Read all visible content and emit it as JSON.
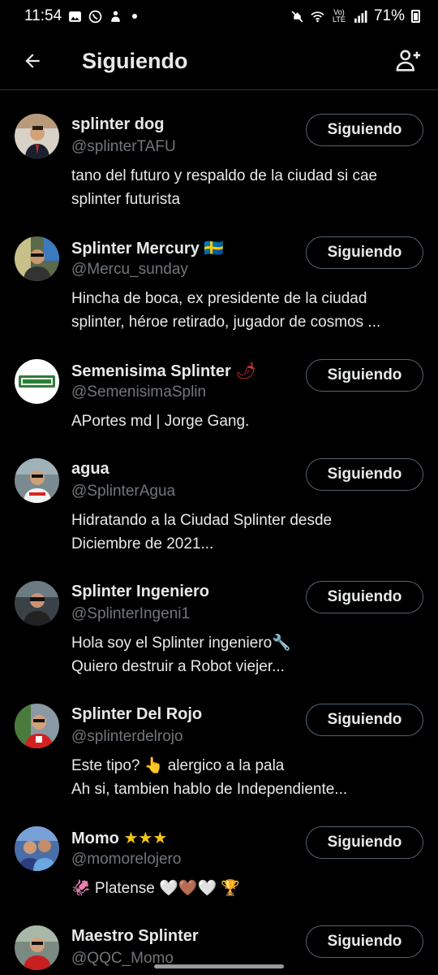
{
  "status_bar": {
    "time": "11:54",
    "battery": "71%",
    "network": "Vo) LTE"
  },
  "header": {
    "title": "Siguiendo"
  },
  "accounts": [
    {
      "name": "splinter dog",
      "badge": "",
      "handle": "@splinterTAFU",
      "bio": "tano del futuro y respaldo de la ciudad si cae\nsplinter futurista",
      "button": "Siguiendo"
    },
    {
      "name": "Splinter Mercury",
      "badge": "🇸🇪",
      "handle": "@Mercu_sunday",
      "bio": "Hincha de boca, ex presidente de la ciudad\nsplinter, héroe retirado, jugador de cosmos ...",
      "button": "Siguiendo"
    },
    {
      "name": "Semenisima Splinter",
      "badge": "🌶",
      "handle": "@SemenisimaSplin",
      "bio": "APortes md | Jorge Gang.",
      "button": "Siguiendo"
    },
    {
      "name": "agua",
      "badge": "",
      "handle": "@SplinterAgua",
      "bio": "Hidratando a la Ciudad Splinter desde\nDiciembre de 2021...",
      "button": "Siguiendo"
    },
    {
      "name": "Splinter Ingeniero",
      "badge": "",
      "handle": "@SplinterIngeni1",
      "bio": "Hola soy el Splinter ingeniero🔧\nQuiero destruir a Robot viejer...",
      "button": "Siguiendo"
    },
    {
      "name": "Splinter Del Rojo",
      "badge": "",
      "handle": "@splinterdelrojo",
      "bio": "Este tipo? 👆 alergico a la pala\nAh si, tambien hablo de Independiente...",
      "button": "Siguiendo"
    },
    {
      "name": "Momo",
      "badge": "★★★",
      "handle": "@momorelojero",
      "bio": "🦑 Platense 🤍🤎🤍 🏆",
      "button": "Siguiendo"
    },
    {
      "name": "Maestro Splinter",
      "badge": "",
      "handle": "@QQC_Momo",
      "bio": "",
      "button": "Siguiendo"
    }
  ],
  "colors": {
    "background": "#000000",
    "text": "#e7e9ea",
    "secondary_text": "#71767b",
    "button_border": "#536471",
    "divider": "#2f3336"
  },
  "icons": [
    "back-arrow-icon",
    "add-person-icon",
    "gallery-icon",
    "whatsapp-icon",
    "notification-icon",
    "mute-icon",
    "wifi-icon",
    "signal-icon",
    "battery-icon"
  ]
}
